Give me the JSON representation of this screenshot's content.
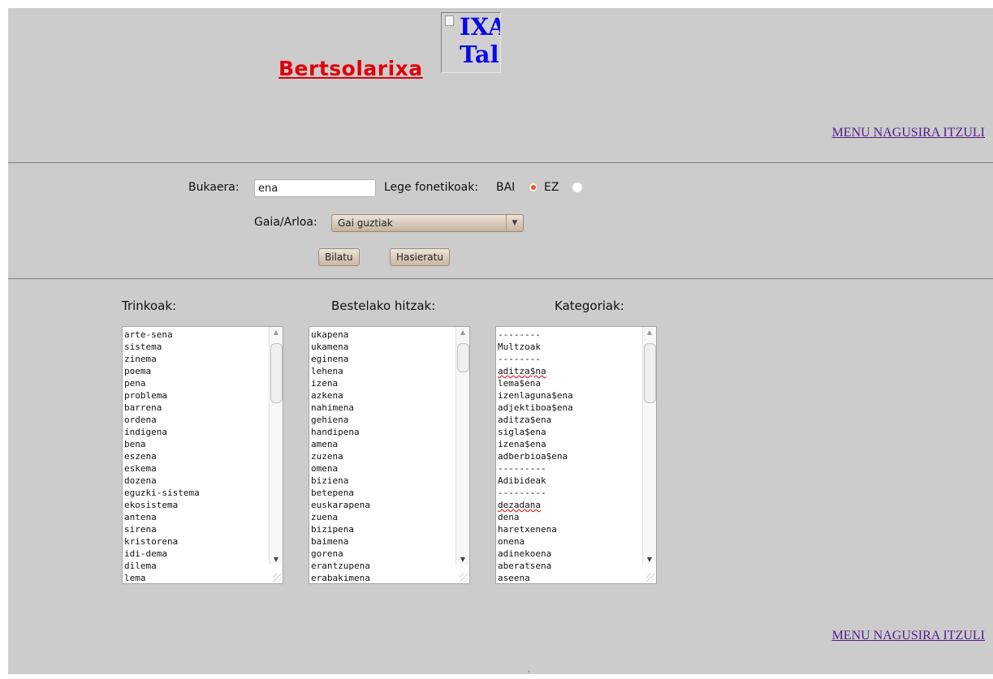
{
  "header": {
    "title": "Bertsolarixa",
    "logo_alt": "IXA\nTal",
    "menu_link": "MENU NAGUSIRA ITZULI"
  },
  "form": {
    "ending_label": "Bukaera:",
    "ending_value": "ena",
    "phonetic_label": "Lege fonetikoak:",
    "yes_label": "BAI",
    "no_label": "EZ",
    "phonetic_selected": "BAI",
    "topic_label": "Gaia/Arloa:",
    "topic_value": "Gai guztiak",
    "search_button": "Bilatu",
    "reset_button": "Hasieratu"
  },
  "results": {
    "compact": {
      "heading": "Trinkoak:",
      "items": [
        "arte-sena",
        "sistema",
        "zinema",
        "poema",
        "pena",
        "problema",
        "barrena",
        "ordena",
        "indigena",
        "bena",
        "eszena",
        "eskema",
        "dozena",
        "eguzki-sistema",
        "ekosistema",
        "antena",
        "sirena",
        "kristorena",
        "idi-dema",
        "dilema",
        "lema"
      ]
    },
    "other": {
      "heading": "Bestelako hitzak:",
      "items": [
        "ukapena",
        "ukamena",
        "eginena",
        "lehena",
        "izena",
        "azkena",
        "nahimena",
        "gehiena",
        "handipena",
        "amena",
        "zuzena",
        "omena",
        "biziena",
        "betepena",
        "euskarapena",
        "zuena",
        "bizipena",
        "baimena",
        "gorena",
        "erantzupena",
        "erabakimena"
      ]
    },
    "categories": {
      "heading": "Kategoriak:",
      "items": [
        "--------",
        "Multzoak",
        "--------",
        "aditza$na",
        "lema$ena",
        "izenlaguna$ena",
        "adjektiboa$ena",
        "aditza$ena",
        "sigla$ena",
        "izena$ena",
        "adberbioa$ena",
        "---------",
        "Adibideak",
        "---------",
        "dezadana",
        "dena",
        "haretxenena",
        "onena",
        "adinekoena",
        "aberatsena",
        "aseena"
      ]
    }
  },
  "footer": {
    "menu_link": "MENU NAGUSIRA ITZULI"
  }
}
